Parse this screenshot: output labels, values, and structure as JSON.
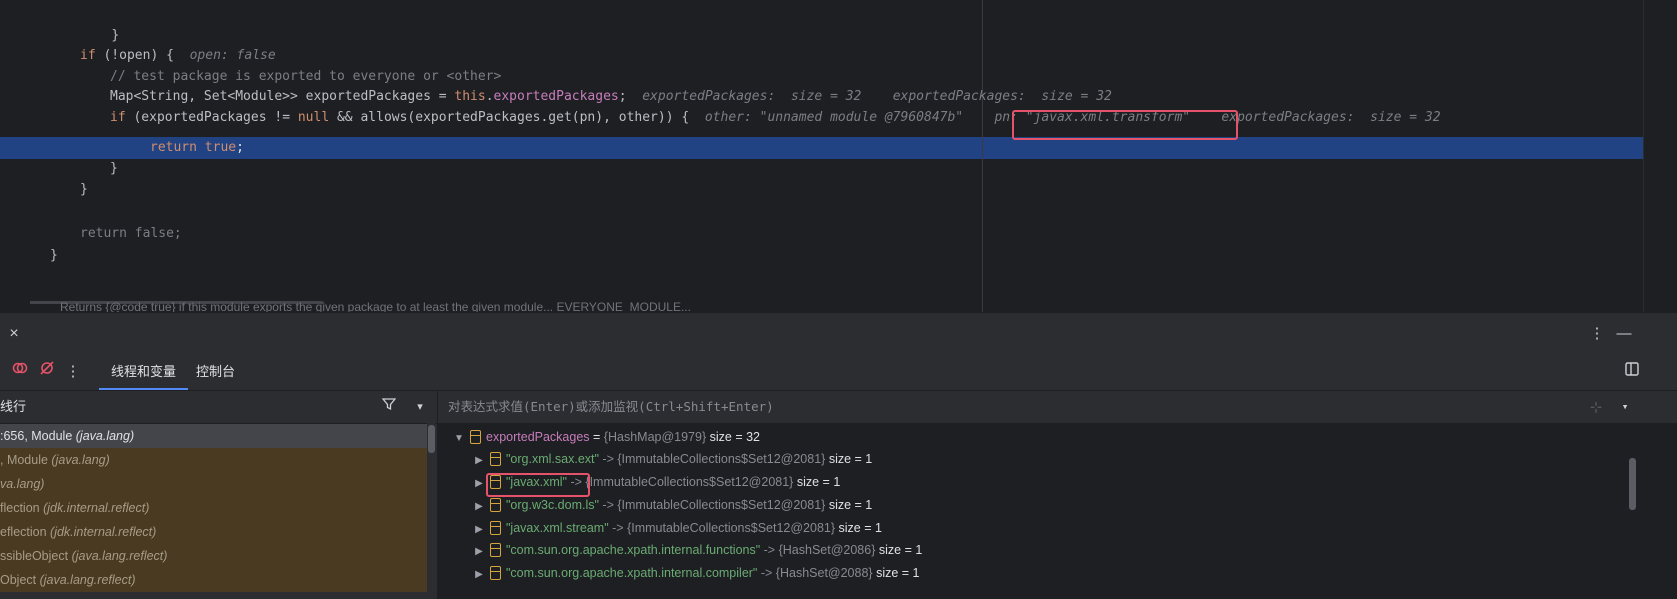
{
  "editor": {
    "lines": {
      "l1_close": "}",
      "l2_if": "if",
      "l2_cond": " (!open) {",
      "l2_hint": "open: false",
      "l3_comment": "// test package is exported to everyone or <other>",
      "l4_decl": "Map<String, Set<Module>> exportedPackages = ",
      "l4_this": "this",
      "l4_dot": ".",
      "l4_field": "exportedPackages",
      "l4_semi": ";",
      "l4_hint1": "exportedPackages:  size = 32",
      "l4_hint2": "exportedPackages:  size = 32",
      "l5_if": "if",
      "l5_a": " (exportedPackages != ",
      "l5_null": "null",
      "l5_b": " && allows(exportedPackages.get(pn), other)) {",
      "l5_hint1": "other: \"unnamed module @7960847b\"",
      "l5_hint2": "pn: \"javax.xml.transform\"",
      "l5_hint3": "exportedPackages:  size = 32",
      "l6_return": "return",
      "l6_true": "true",
      "l6_semi": ";",
      "l7_close": "}",
      "l8_close": "}",
      "l9_return": "return false;",
      "l10_close": "}"
    },
    "peek_text": "Returns {@code true} if this module exports the given package to at least the given module... EVERYONE_MODULE..."
  },
  "debug_panel": {
    "close_glyph": "×",
    "more_glyph": "⋮",
    "minimize_glyph": "—",
    "tabs": [
      {
        "label": "线程和变量",
        "active": true
      },
      {
        "label": "控制台",
        "active": false
      }
    ]
  },
  "frames": {
    "header": "线行",
    "rows": [
      {
        "text": ":656, Module ",
        "pkg": "(java.lang)",
        "kind": "selected"
      },
      {
        "text": ", Module ",
        "pkg": "(java.lang)",
        "kind": "library"
      },
      {
        "text": "",
        "pkg": "va.lang)",
        "kind": "library"
      },
      {
        "text": "flection ",
        "pkg": "(jdk.internal.reflect)",
        "kind": "library"
      },
      {
        "text": "eflection ",
        "pkg": "(jdk.internal.reflect)",
        "kind": "library"
      },
      {
        "text": "ssibleObject ",
        "pkg": "(java.lang.reflect)",
        "kind": "library"
      },
      {
        "text": "Object ",
        "pkg": "(java.lang.reflect)",
        "kind": "library"
      }
    ]
  },
  "variables": {
    "eval_placeholder": "对表达式求值(Enter)或添加监视(Ctrl+Shift+Enter)",
    "root": {
      "name": "exportedPackages",
      "eq": " = ",
      "type": "{HashMap@1979}",
      "value": "size = 32"
    },
    "entries": [
      {
        "key": "\"org.xml.sax.ext\"",
        "arrow": " -> ",
        "type": "{ImmutableCollections$Set12@2081}",
        "value": "size = 1"
      },
      {
        "key": "\"javax.xml\"",
        "arrow": " -> ",
        "type": "{ImmutableCollections$Set12@2081}",
        "value": "size = 1"
      },
      {
        "key": "\"org.w3c.dom.ls\"",
        "arrow": " -> ",
        "type": "{ImmutableCollections$Set12@2081}",
        "value": "size = 1"
      },
      {
        "key": "\"javax.xml.stream\"",
        "arrow": " -> ",
        "type": "{ImmutableCollections$Set12@2081}",
        "value": "size = 1"
      },
      {
        "key": "\"com.sun.org.apache.xpath.internal.functions\"",
        "arrow": " -> ",
        "type": "{HashSet@2086}",
        "value": "size = 1"
      },
      {
        "key": "\"com.sun.org.apache.xpath.internal.compiler\"",
        "arrow": " -> ",
        "type": "{HashSet@2088}",
        "value": "size = 1"
      }
    ]
  },
  "colors": {
    "execution_line": "#214283",
    "highlight_box": "#e5536a",
    "string": "#6aab73",
    "keyword": "#cf8e6d",
    "field": "#c77dbb"
  }
}
